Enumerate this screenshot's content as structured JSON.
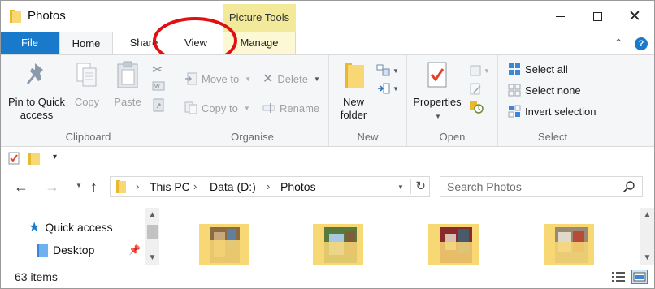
{
  "window": {
    "title": "Photos",
    "contextual_tab_group": "Picture Tools"
  },
  "ribbon_tabs": [
    "File",
    "Home",
    "Share",
    "View",
    "Manage"
  ],
  "ribbon": {
    "clipboard": {
      "group_label": "Clipboard",
      "pin_label": "Pin to Quick access",
      "copy_label": "Copy",
      "paste_label": "Paste"
    },
    "organise": {
      "group_label": "Organise",
      "move_to": "Move to",
      "copy_to": "Copy to",
      "delete": "Delete",
      "rename": "Rename"
    },
    "new": {
      "group_label": "New",
      "new_folder": "New folder"
    },
    "open": {
      "group_label": "Open",
      "properties": "Properties"
    },
    "select": {
      "group_label": "Select",
      "select_all": "Select all",
      "select_none": "Select none",
      "invert_selection": "Invert selection"
    }
  },
  "address": {
    "crumbs": [
      "This PC",
      "Data (D:)",
      "Photos"
    ]
  },
  "search": {
    "placeholder": "Search Photos"
  },
  "nav_pane": {
    "items": [
      "Quick access",
      "Desktop"
    ]
  },
  "status": {
    "item_count": "63 items"
  },
  "colors": {
    "file_tab": "#1979ca",
    "picture_tools": "#f2ea9a",
    "annotation_circle": "#e01010",
    "folder_yellow": "#f8d775"
  }
}
